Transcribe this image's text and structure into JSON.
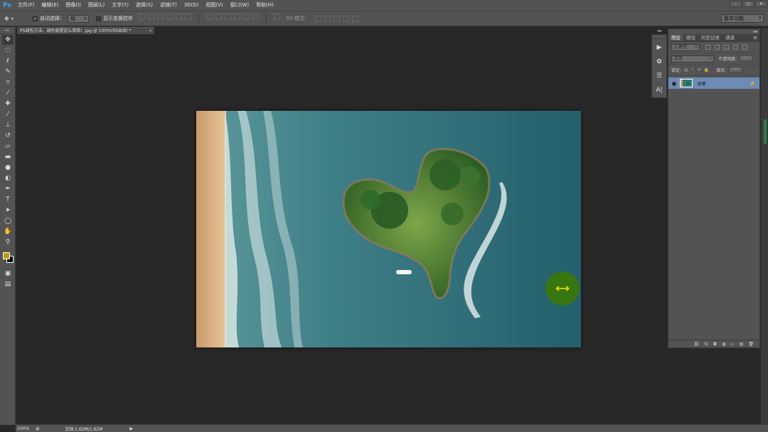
{
  "app": {
    "logo": "Ps"
  },
  "menu": [
    "文件(F)",
    "编辑(E)",
    "图像(I)",
    "图层(L)",
    "文字(Y)",
    "选择(S)",
    "滤镜(T)",
    "3D(D)",
    "视图(V)",
    "窗口(W)",
    "帮助(H)"
  ],
  "window_buttons": [
    "–",
    "▢",
    "✕"
  ],
  "options": {
    "auto_select_label": "自动选择：",
    "auto_select_value": "组",
    "show_transform_label": "显示变换控件",
    "mode_label": "3D 模式：",
    "workspace": "基本功能"
  },
  "document": {
    "tab_title": "PS调色方法、调色就是这么简单! .jpg @ 100%(RGB/8) *",
    "tab_close": "×"
  },
  "status": {
    "zoom": "100%",
    "doc_info": "文档:1.62M/1.62M",
    "arrow": "▶"
  },
  "layers_panel": {
    "tabs": [
      "图层",
      "路径",
      "历史记录",
      "通道"
    ],
    "kind_filter": "ρ 类型",
    "blend_mode": "正常",
    "opacity_label": "不透明度:",
    "opacity_value": "100%",
    "lock_label": "锁定:",
    "fill_label": "填充:",
    "fill_value": "100%",
    "layer_name": "背景",
    "collapse": "◂◂",
    "menu": "≡"
  },
  "colors": {
    "foreground": "#b89c10",
    "background": "#000000",
    "ui_panel": "#535353",
    "canvas_bg": "#282828",
    "accent_ps_blue": "#31a8ff",
    "selection_highlight": "#6d8bb5"
  },
  "icons": {
    "toolbar": [
      "move-icon",
      "marquee-icon",
      "lasso-icon",
      "quick-select-icon",
      "crop-icon",
      "eyedropper-icon",
      "spot-healing-icon",
      "brush-icon",
      "clone-stamp-icon",
      "history-brush-icon",
      "eraser-icon",
      "gradient-icon",
      "blur-icon",
      "dodge-icon",
      "pen-icon",
      "type-icon",
      "path-select-icon",
      "shape-icon",
      "hand-icon",
      "zoom-icon"
    ],
    "icon_strip": [
      "play-icon",
      "brush-panel-icon",
      "adjust-icon",
      "character-icon"
    ]
  }
}
